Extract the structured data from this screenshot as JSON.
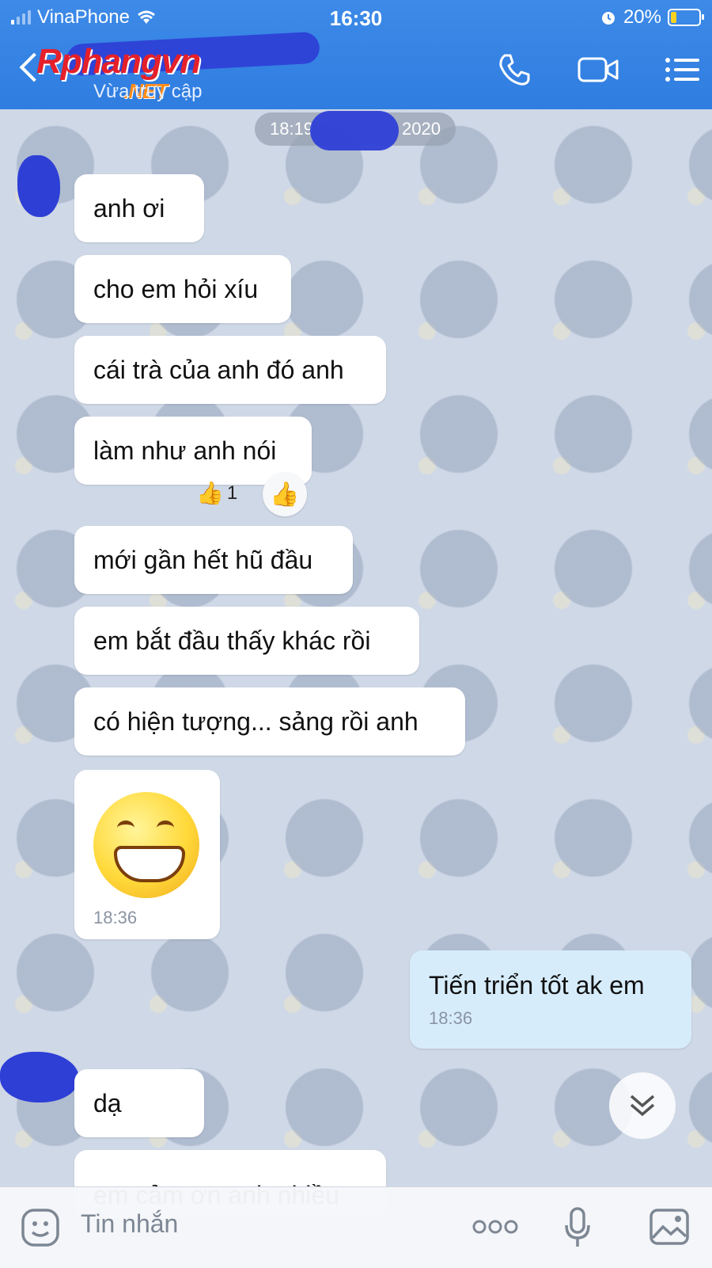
{
  "status_bar": {
    "carrier": "VinaPhone",
    "time": "16:30",
    "battery": "20%",
    "battery_level": 0.2
  },
  "header": {
    "logo_brand": "Rphangvn",
    "logo_net": ".NET",
    "subtitle": "Vừa truy cập",
    "icons": [
      "back-icon",
      "phone-icon",
      "video-icon",
      "menu-icon"
    ]
  },
  "date_pill": {
    "left": "18:19",
    "right": "2020"
  },
  "messages": [
    {
      "text": "anh ơi"
    },
    {
      "text": "cho em hỏi xíu"
    },
    {
      "text": "cái trà của anh đó anh"
    },
    {
      "text": "làm như anh nói"
    },
    {
      "text": "mới gần hết hũ đầu"
    },
    {
      "text": "em bắt đầu thấy khác rồi"
    },
    {
      "text": "có hiện tượng... sảng rồi anh"
    },
    {
      "text": "dạ"
    },
    {
      "text": "em cảm ơn anh nhiều"
    }
  ],
  "reaction": {
    "count": "1",
    "icon": "thumbs-up-icon"
  },
  "sticker": {
    "icon": "grinning-emoji",
    "time": "18:36"
  },
  "my_message": {
    "text": "Tiến triển tốt ak em",
    "time": "18:36"
  },
  "input": {
    "placeholder": "Tin nhắn",
    "icons": [
      "sticker-icon",
      "more-icon",
      "microphone-icon",
      "image-icon"
    ]
  },
  "colors": {
    "header": "#2f7de0",
    "my_bubble": "#d7ecfb",
    "bubble": "#ffffff",
    "logo_red": "#e5202a",
    "logo_orange": "#ff8c1a"
  }
}
